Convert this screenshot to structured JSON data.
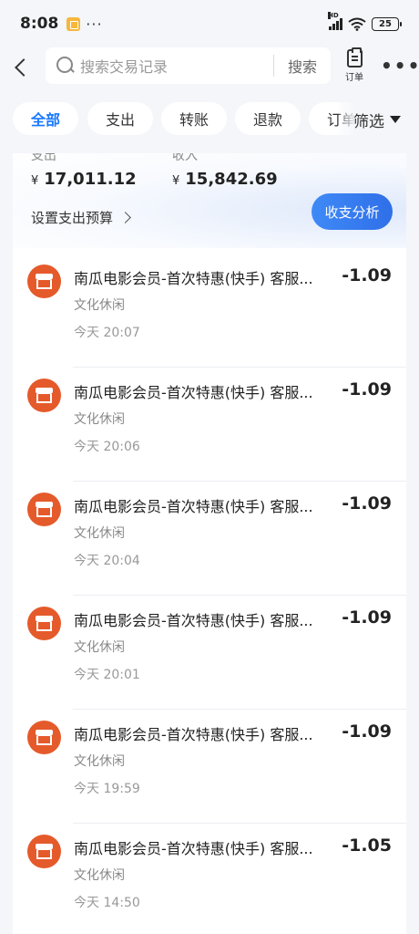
{
  "status_bar": {
    "time": "8:08",
    "dots": "···",
    "network": "HD",
    "battery": "25"
  },
  "search": {
    "placeholder": "搜索交易记录",
    "button": "搜索",
    "order_label": "订单",
    "more": "•••"
  },
  "filters": {
    "chips": [
      "全部",
      "支出",
      "转账",
      "退款",
      "订单"
    ],
    "active": "全部",
    "filter_label": "筛选"
  },
  "summary": {
    "expense_label": "支出",
    "expense_currency": "¥",
    "expense_value": "17,011.12",
    "income_label": "收入",
    "income_currency": "¥",
    "income_value": "15,842.69",
    "budget_link": "设置支出预算",
    "analysis_button": "收支分析"
  },
  "transactions": [
    {
      "title": "南瓜电影会员-首次特惠(快手) 客服...",
      "amount": "-1.09",
      "category": "文化休闲",
      "time": "今天 20:07"
    },
    {
      "title": "南瓜电影会员-首次特惠(快手) 客服...",
      "amount": "-1.09",
      "category": "文化休闲",
      "time": "今天 20:06"
    },
    {
      "title": "南瓜电影会员-首次特惠(快手) 客服...",
      "amount": "-1.09",
      "category": "文化休闲",
      "time": "今天 20:04"
    },
    {
      "title": "南瓜电影会员-首次特惠(快手) 客服...",
      "amount": "-1.09",
      "category": "文化休闲",
      "time": "今天 20:01"
    },
    {
      "title": "南瓜电影会员-首次特惠(快手) 客服...",
      "amount": "-1.09",
      "category": "文化休闲",
      "time": "今天 19:59"
    },
    {
      "title": "南瓜电影会员-首次特惠(快手) 客服...",
      "amount": "-1.05",
      "category": "文化休闲",
      "time": "今天 14:50"
    }
  ],
  "colors": {
    "accent": "#1677ff",
    "icon_bg": "#e55a2b",
    "page_bg": "#f4f6fa"
  }
}
